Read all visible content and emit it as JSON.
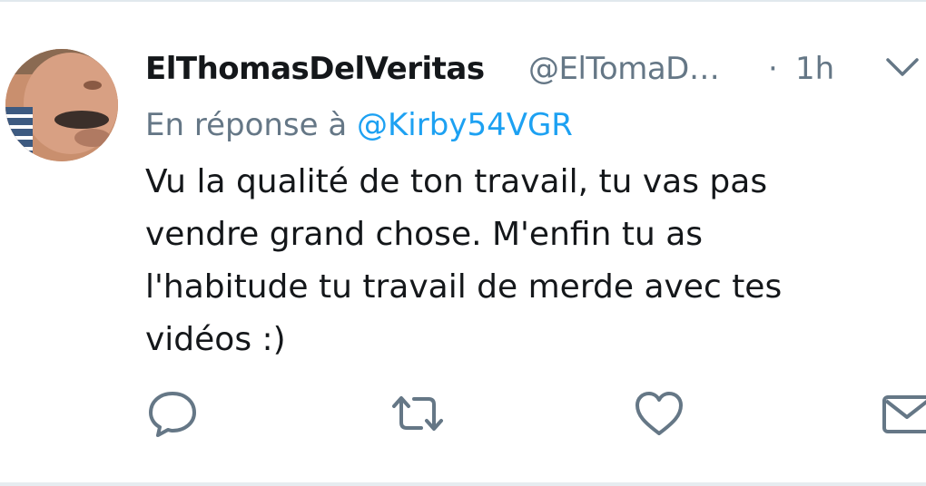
{
  "tweet": {
    "display_name": "ElThomasDelVeritas",
    "handle": "@ElTomaD…",
    "separator": "·",
    "time": "1h",
    "reply_prefix": "En réponse à ",
    "reply_to": "@Kirby54VGR",
    "text_lines": [
      "Vu la qualité de ton travail, tu vas pas",
      "vendre grand chose. M'enfin tu as",
      "l'habitude tu travail de merde avec tes",
      "vidéos :)"
    ]
  },
  "icons": {
    "avatar": "avatar-photo",
    "menu": "chevron-down-icon",
    "reply": "reply-bubble-icon",
    "retweet": "retweet-icon",
    "like": "heart-icon",
    "dm": "envelope-icon"
  },
  "colors": {
    "name": "#14171a",
    "muted": "#657786",
    "link": "#1da1f2",
    "divider": "#e1e8ed"
  }
}
